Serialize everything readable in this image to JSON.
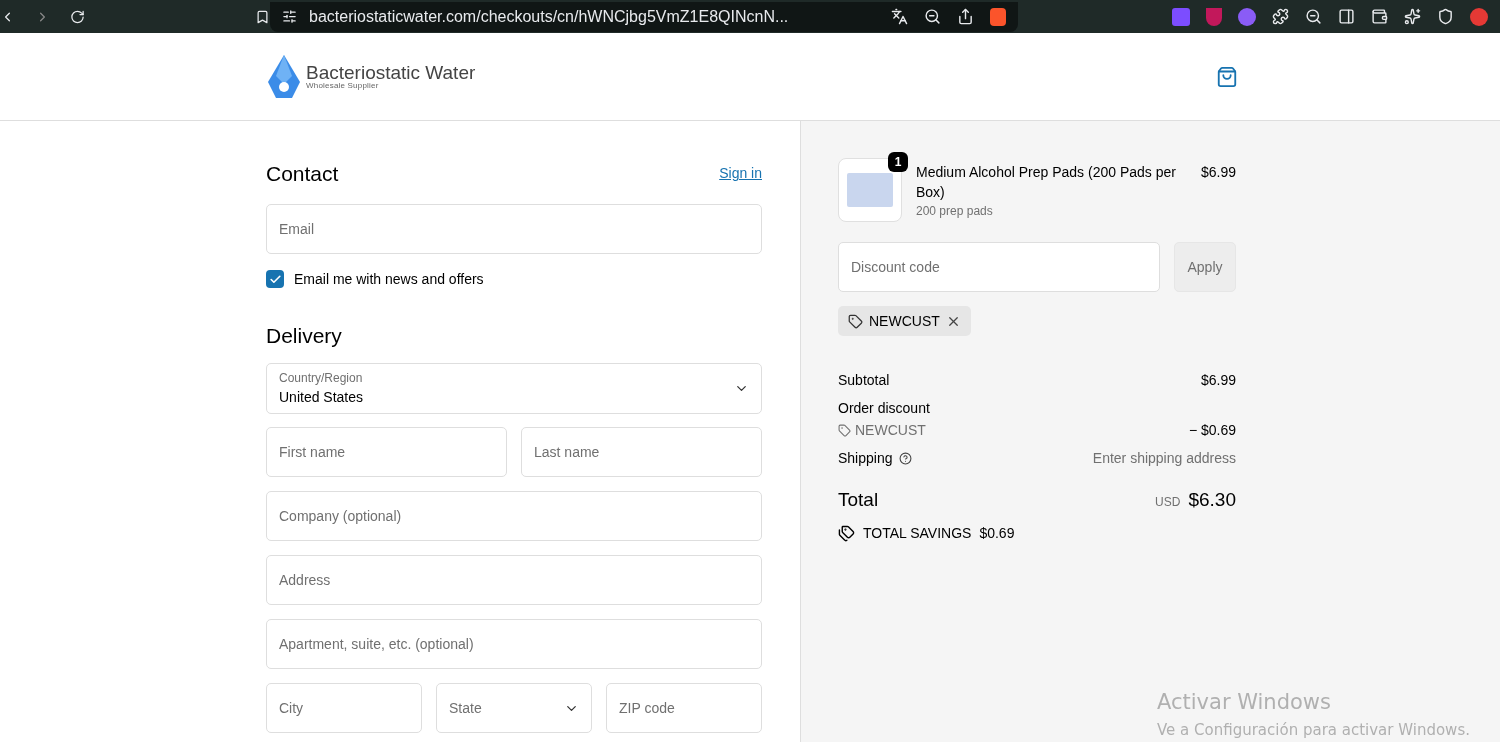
{
  "browser": {
    "url": "bacteriostaticwater.com/checkouts/cn/hWNCjbg5VmZ1E8QINcnN..."
  },
  "header": {
    "logo_title": "Bacteriostatic Water",
    "logo_subtitle": "Wholesale Supplier"
  },
  "contact": {
    "heading": "Contact",
    "sign_in": "Sign in",
    "email_placeholder": "Email",
    "newsletter": {
      "label": "Email me with news and offers",
      "checked": true
    }
  },
  "delivery": {
    "heading": "Delivery",
    "country": {
      "label": "Country/Region",
      "value": "United States"
    },
    "rows": [
      [
        {
          "kind": "text",
          "placeholder": "First name"
        },
        {
          "kind": "text",
          "placeholder": "Last name"
        }
      ],
      [
        {
          "kind": "text",
          "placeholder": "Company (optional)"
        }
      ],
      [
        {
          "kind": "text",
          "placeholder": "Address"
        }
      ],
      [
        {
          "kind": "text",
          "placeholder": "Apartment, suite, etc. (optional)"
        }
      ],
      [
        {
          "kind": "text",
          "placeholder": "City"
        },
        {
          "kind": "select",
          "placeholder": "State"
        },
        {
          "kind": "text",
          "placeholder": "ZIP code"
        }
      ]
    ]
  },
  "summary": {
    "item": {
      "name": "Medium Alcohol Prep Pads (200 Pads per Box)",
      "variant": "200 prep pads",
      "quantity": "1",
      "price": "$6.99"
    },
    "discount": {
      "placeholder": "Discount code",
      "apply": "Apply",
      "tag": "NEWCUST"
    },
    "subtotal": {
      "label": "Subtotal",
      "value": "$6.99"
    },
    "order_discount": {
      "label": "Order discount",
      "code": "NEWCUST",
      "value": "− $0.69"
    },
    "shipping": {
      "label": "Shipping",
      "value": "Enter shipping address"
    },
    "total": {
      "label": "Total",
      "currency": "USD",
      "value": "$6.30"
    },
    "savings": {
      "label": "TOTAL SAVINGS",
      "value": "$0.69"
    }
  },
  "os_notice": {
    "title": "Activar Windows",
    "text": "Ve a Configuración para activar Windows."
  }
}
